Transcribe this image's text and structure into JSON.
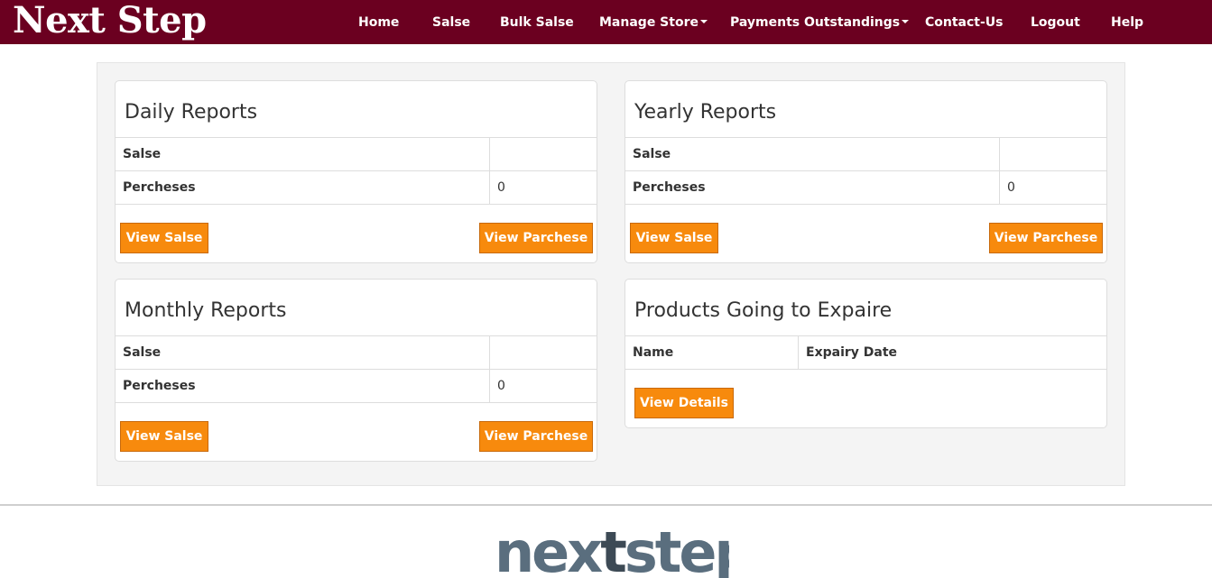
{
  "brand": "Next Step",
  "nav": {
    "home": "Home",
    "salse": "Salse",
    "bulk_salse": "Bulk Salse",
    "manage_store": "Manage Store",
    "payments": "Payments Outstandings",
    "contact": "Contact-Us",
    "logout": "Logout",
    "help": "Help"
  },
  "daily": {
    "title": "Daily Reports",
    "row1_label": "Salse",
    "row1_value": "",
    "row2_label": "Percheses",
    "row2_value": "0",
    "btn_salse": "View Salse",
    "btn_parchese": "View Parchese"
  },
  "yearly": {
    "title": "Yearly Reports",
    "row1_label": "Salse",
    "row1_value": "",
    "row2_label": "Percheses",
    "row2_value": "0",
    "btn_salse": "View Salse",
    "btn_parchese": "View Parchese"
  },
  "monthly": {
    "title": "Monthly Reports",
    "row1_label": "Salse",
    "row1_value": "",
    "row2_label": "Percheses",
    "row2_value": "0",
    "btn_salse": "View Salse",
    "btn_parchese": "View Parchese"
  },
  "expiry": {
    "title": "Products Going to Expaire",
    "col_name": "Name",
    "col_date": "Expairy Date",
    "btn_details": "View Details"
  },
  "footer": {
    "logo_a": "nex",
    "logo_t": "t",
    "logo_b": "step"
  },
  "colors": {
    "navbar": "#6b0020",
    "button": "#f78a0d"
  }
}
